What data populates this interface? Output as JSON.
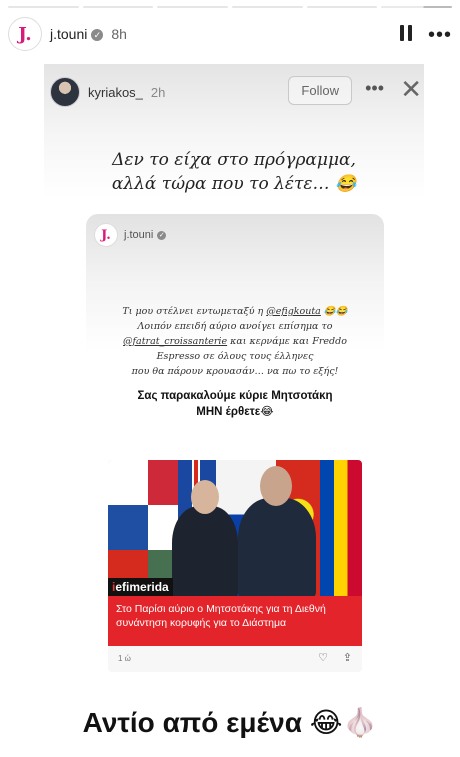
{
  "story": {
    "progress_segments": 6,
    "progress_done": 5,
    "user": "j.touni",
    "avatar_letter": "J.",
    "time": "8h"
  },
  "inner_story": {
    "user": "kyriakos_",
    "time": "2h",
    "follow_label": "Follow",
    "caption_line1": "Δεν το είχα στο πρόγραμμα,",
    "caption_line2": "αλλά τώρα που το λέτε…"
  },
  "repost": {
    "user": "j.touni",
    "avatar_letter": "J.",
    "line1_pre": "Τι μου στέλνει εντωμεταξύ η ",
    "mention1": "@efigkouta",
    "line2": "Λοιπόν επειδή αύριο ανοίγει επίσημα το",
    "mention2": "@fatrat_croissanterie",
    "line3_post": " και κερνάμε και Freddo",
    "line4": "Espresso σε όλους τους έλληνες",
    "line5": "που θα πάρουν κρουασάν… να πω το εξής!",
    "plea_line1": "Σας παρακαλούμε κύριε Μητσοτάκη",
    "plea_line2": "ΜΗΝ έρθετε"
  },
  "news_card": {
    "logo_first": "i",
    "logo_rest": "efimerida",
    "title": "Στο Παρίσι αύριο ο Μητσοτάκης για τη Διεθνή συνάντηση κορυφής για το Διάστημα",
    "age": "1 ώ"
  },
  "bottom": {
    "text": "Αντίο από εμένα"
  },
  "icons": {
    "laugh_emoji": "😂",
    "garlic_emoji": "🧄",
    "pause": "pause-icon",
    "more": "more-icon",
    "close": "close-icon",
    "heart": "heart-icon",
    "share": "share-icon"
  },
  "colors": {
    "brand_pink": "#d81b7a",
    "news_red": "#e3242b"
  }
}
